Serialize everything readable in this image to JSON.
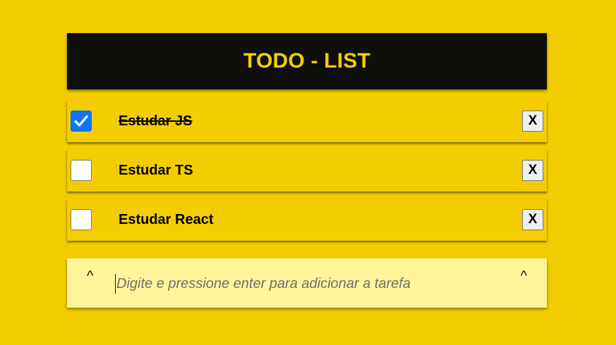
{
  "header": {
    "title": "TODO - LIST"
  },
  "todos": [
    {
      "label": "Estudar JS",
      "done": true,
      "delete_label": "X"
    },
    {
      "label": "Estudar TS",
      "done": false,
      "delete_label": "X"
    },
    {
      "label": "Estudar React",
      "done": false,
      "delete_label": "X"
    }
  ],
  "new_task": {
    "placeholder": "Digite e pressione enter para adicionar a tarefa",
    "value": "",
    "left_glyph": "^",
    "right_glyph": "^"
  },
  "colors": {
    "background": "#f4cd00",
    "header_bg": "#0f0f0c",
    "title": "#f4cd00",
    "input_bg": "#fff59a",
    "checked": "#0a75ff"
  }
}
